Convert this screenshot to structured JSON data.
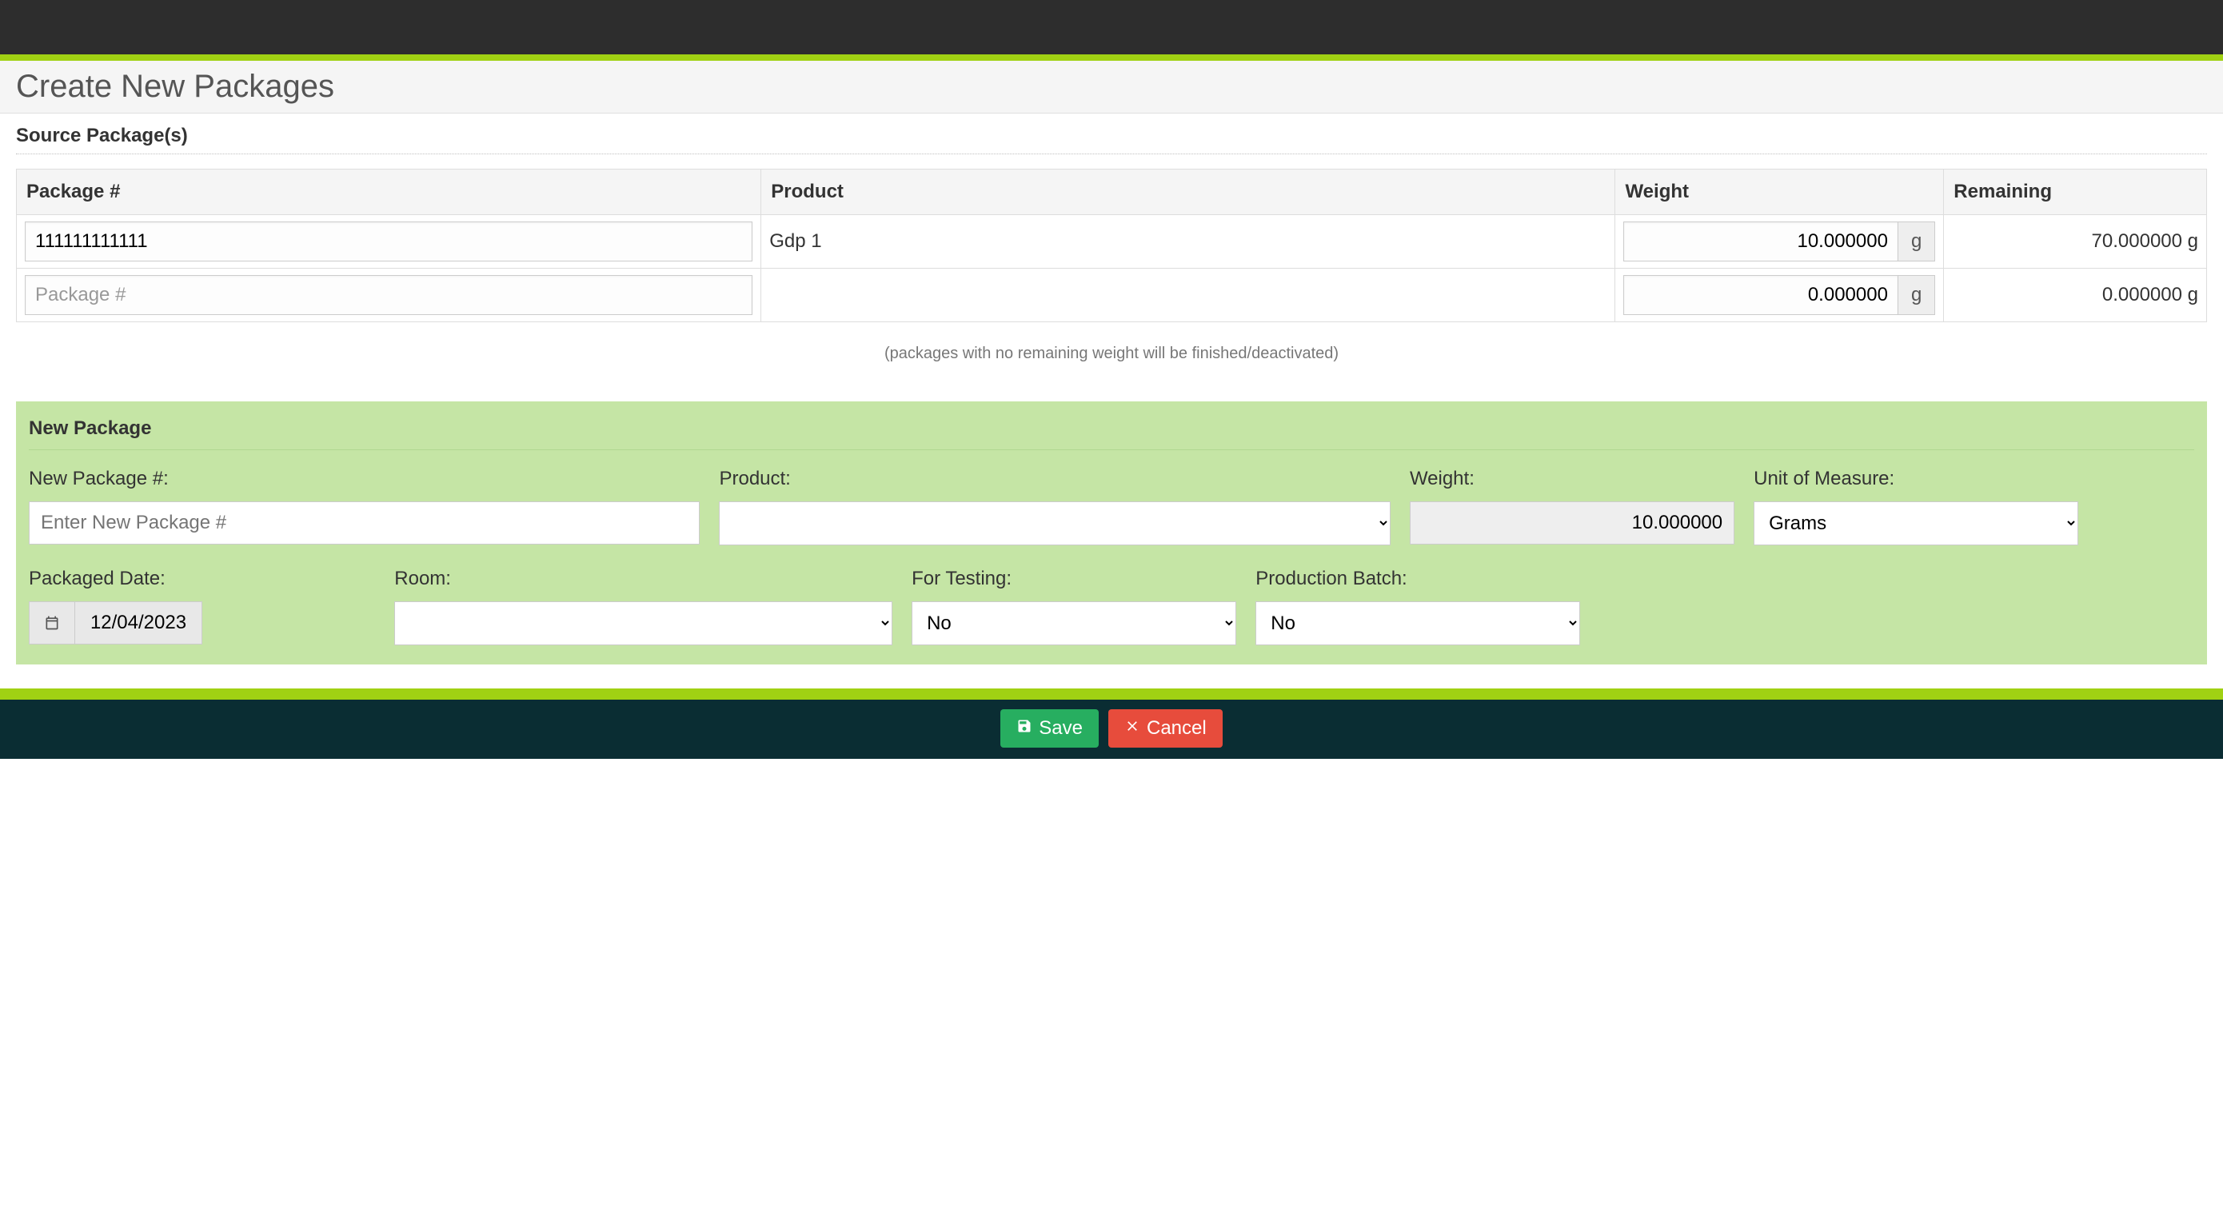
{
  "page": {
    "title": "Create New Packages",
    "hint": "(packages with no remaining weight will be finished/deactivated)"
  },
  "source": {
    "heading": "Source Package(s)",
    "columns": {
      "package": "Package #",
      "product": "Product",
      "weight": "Weight",
      "remaining": "Remaining"
    },
    "rows": [
      {
        "packageNum": "111111111111",
        "placeholder": "",
        "product": "Gdp 1",
        "weight": "10.000000",
        "unit": "g",
        "remaining": "70.000000 g"
      },
      {
        "packageNum": "",
        "placeholder": "Package #",
        "product": "",
        "weight": "0.000000",
        "unit": "g",
        "remaining": "0.000000 g"
      }
    ]
  },
  "newPackage": {
    "heading": "New Package",
    "labels": {
      "newPackageNum": "New Package #:",
      "product": "Product:",
      "weight": "Weight:",
      "unit": "Unit of Measure:",
      "packagedDate": "Packaged Date:",
      "room": "Room:",
      "forTesting": "For Testing:",
      "productionBatch": "Production Batch:"
    },
    "values": {
      "newPackageNum": "",
      "newPackagePlaceholder": "Enter New Package #",
      "product": "",
      "weight": "10.000000",
      "unit": "Grams",
      "packagedDate": "12/04/2023",
      "room": "",
      "forTesting": "No",
      "productionBatch": "No"
    }
  },
  "actions": {
    "save": "Save",
    "cancel": "Cancel"
  }
}
